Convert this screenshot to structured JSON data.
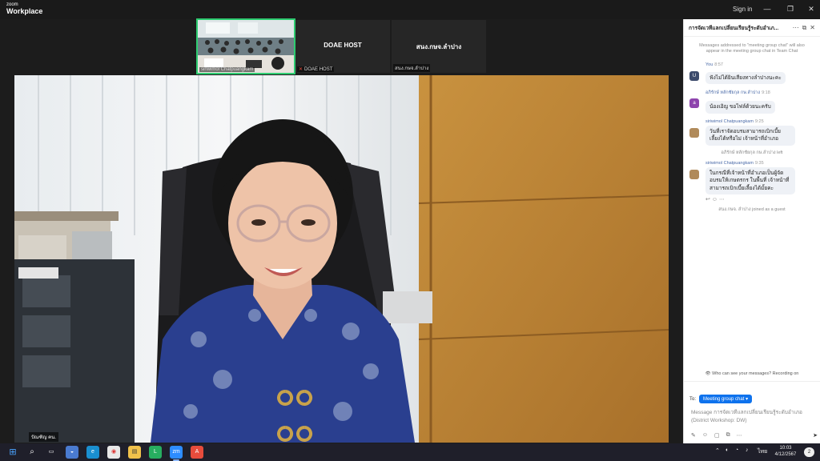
{
  "titlebar": {
    "brand_small": "zoom",
    "brand_large": "Workplace",
    "signin": "Sign in",
    "minimize": "—",
    "restore": "❐",
    "close": "✕"
  },
  "thumbnails": [
    {
      "name": "siriwimol Chatpuangkam",
      "center_label": ""
    },
    {
      "name": "DOAE HOST",
      "center_label": "DOAE HOST"
    },
    {
      "name": "สนง.กษจ.ลำปาง",
      "center_label": "สนง.กษจ.ลำปาง"
    }
  ],
  "main_video": {
    "name": "ปัณฑิญ คน."
  },
  "chat": {
    "title": "การจัดเวทีแลกเปลี่ยนเรียนรู้ระดับอำเภ...",
    "notice": "Messages addressed to \"meeting group chat\" will also appear in the meeting group chat in Team Chat",
    "messages": [
      {
        "avatar": "U",
        "avatar_color": "#3b4a6b",
        "sender": "You",
        "time": "8:57",
        "text": "ฟังไม่ได้ยินเสียงทางลำปางนะคะ"
      },
      {
        "avatar": "a",
        "avatar_color": "#8e44ad",
        "sender": "อภิรักษ์ หลักชัยกุล กษ.ลำปาง",
        "time": "9:18",
        "text": "น้องเอิญ ขอไฟล์ด้วยนะครับ"
      },
      {
        "avatar": "",
        "avatar_color": "#b08a5a",
        "sender": "siriwimol Chatpuangkam",
        "time": "9:25",
        "text": "วันที่เราจัดอบรมสามารถเบิกเบี้ยเลี้ยงได้หรือไม่ เจ้าหน้าที่อำเภอ"
      },
      {
        "avatar": "",
        "avatar_color": "#b08a5a",
        "sender": "siriwimol Chatpuangkam",
        "time": "9:35",
        "text": "ในกรณีที่เจ้าหน้าที่อำเภอเป็นผู้จัดอบรมให้เกษตรกร ในพื้นที่ เจ้าหน้าที่สามารถเบิกเบี้ยเลี้ยงได้มั้ยคะ"
      }
    ],
    "left_note": "อภิรักษ์ หลักชัยกุล กษ.ลำปาง left",
    "joined_note": "สนง.กษจ. ลำปาง joined as a guest",
    "who_can_see": "Who can see your messages? Recording on",
    "to_label": "To:",
    "to_value": "Meeting group chat",
    "placeholder": "Message การจัดเวทีแลกเปลี่ยนเรียนรู้ระดับอำเภอ (District Workshop: DW)"
  },
  "taskbar": {
    "clock_time": "10:03",
    "clock_date": "4/12/2567",
    "language": "ไทย",
    "notifications": "2"
  }
}
